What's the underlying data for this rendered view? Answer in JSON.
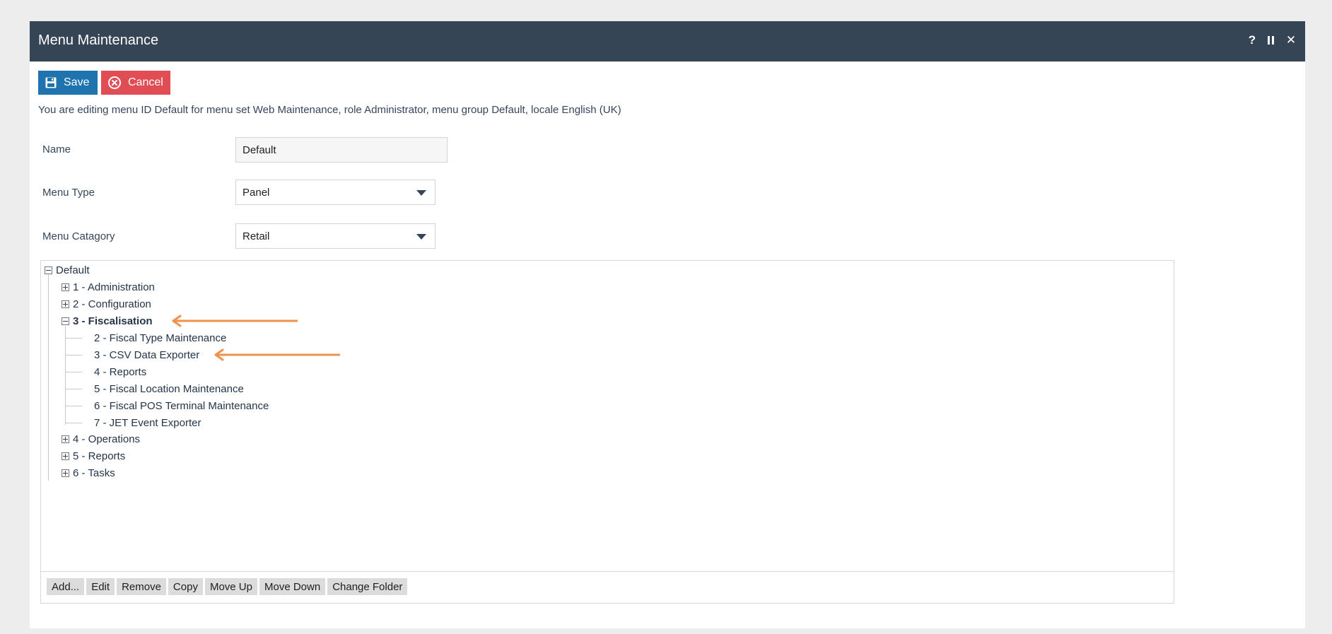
{
  "window": {
    "title": "Menu Maintenance",
    "controls": {
      "help": "?",
      "close": "✕"
    }
  },
  "actions": {
    "save_label": "Save",
    "cancel_label": "Cancel"
  },
  "info_text": "You are editing menu ID Default for menu set Web Maintenance, role Administrator, menu group Default, locale English (UK)",
  "form": {
    "name": {
      "label": "Name",
      "value": "Default"
    },
    "menu_type": {
      "label": "Menu Type",
      "value": "Panel"
    },
    "menu_category": {
      "label": "Menu Catagory",
      "value": "Retail"
    }
  },
  "tree": {
    "root": "Default",
    "folders": [
      {
        "label": "1 - Administration",
        "expanded": false
      },
      {
        "label": "2 - Configuration",
        "expanded": false
      },
      {
        "label": "3 - Fiscalisation",
        "expanded": true,
        "selected": true
      },
      {
        "label": "4 - Operations",
        "expanded": false
      },
      {
        "label": "5 - Reports",
        "expanded": false
      },
      {
        "label": "6 - Tasks",
        "expanded": false
      }
    ],
    "fiscalisation_children": [
      "2 - Fiscal Type Maintenance",
      "3 - CSV Data Exporter",
      "4 - Reports",
      "5 - Fiscal Location Maintenance",
      "6 - Fiscal POS Terminal Maintenance",
      "7 - JET Event Exporter"
    ]
  },
  "toolbar": [
    "Add...",
    "Edit",
    "Remove",
    "Copy",
    "Move Up",
    "Move Down",
    "Change Folder"
  ],
  "colors": {
    "titlebar": "#364556",
    "save": "#1f74b0",
    "cancel": "#e04d55",
    "annotation_arrow": "#f2914a"
  }
}
